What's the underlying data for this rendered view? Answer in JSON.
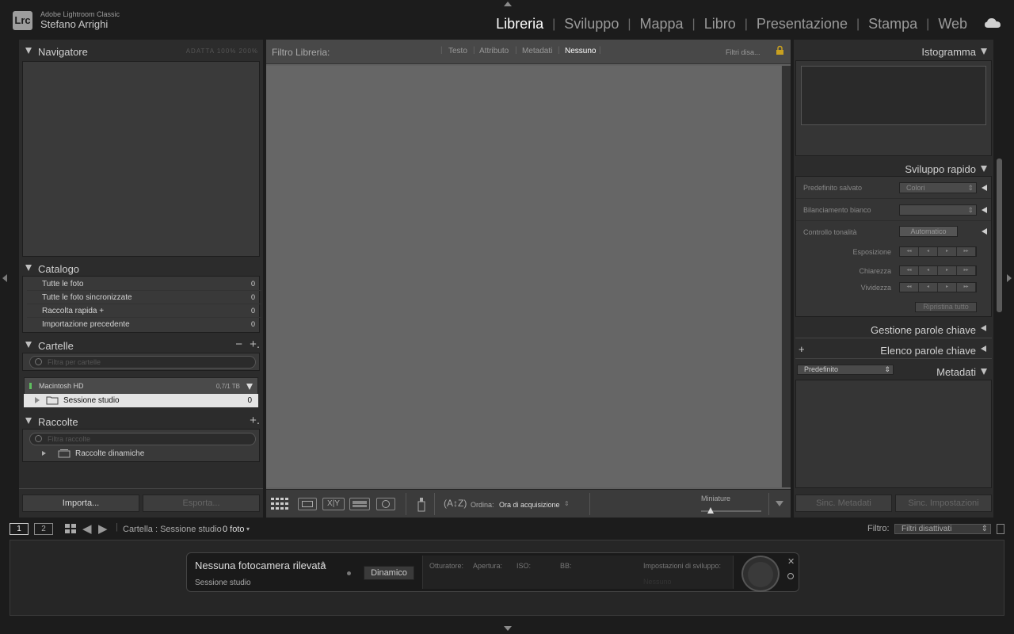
{
  "app": {
    "logo": "Lrc",
    "product": "Adobe Lightroom Classic",
    "user": "Stefano Arrighi"
  },
  "modules": [
    {
      "label": "Libreria",
      "active": true
    },
    {
      "label": "Sviluppo"
    },
    {
      "label": "Mappa"
    },
    {
      "label": "Libro"
    },
    {
      "label": "Presentazione"
    },
    {
      "label": "Stampa"
    },
    {
      "label": "Web"
    }
  ],
  "left": {
    "navigator": {
      "title": "Navigatore",
      "options": "ADATTA  100%  200%"
    },
    "catalog": {
      "title": "Catalogo",
      "items": [
        {
          "label": "Tutte le foto",
          "count": "0"
        },
        {
          "label": "Tutte le foto sincronizzate",
          "count": "0"
        },
        {
          "label": "Raccolta rapida +",
          "count": "0"
        },
        {
          "label": "Importazione precedente",
          "count": "0"
        }
      ]
    },
    "folders": {
      "title": "Cartelle",
      "search_placeholder": "Filtra per cartelle",
      "volume": {
        "name": "Macintosh HD",
        "size": "0,7/1 TB"
      },
      "folder": {
        "name": "Sessione studio",
        "count": "0"
      }
    },
    "collections": {
      "title": "Raccolte",
      "search_placeholder": "Filtra raccolte",
      "item": "Raccolte dinamiche"
    },
    "import_label": "Importa...",
    "export_label": "Esporta..."
  },
  "center": {
    "filter_title": "Filtro Libreria:",
    "filter_tabs": [
      "Testo",
      "Attributo",
      "Metadati",
      "Nessuno"
    ],
    "filter_active": "Nessuno",
    "filter_preset": "Filtri disa...",
    "sort_label": "Ordina:",
    "sort_value": "Ora di acquisizione",
    "thumbnails_label": "Miniature"
  },
  "right": {
    "histogram_title": "Istogramma",
    "quick_develop": {
      "title": "Sviluppo rapido",
      "saved_preset_label": "Predefinito salvato",
      "saved_preset_value": "Colori",
      "wb_label": "Bilanciamento bianco",
      "wb_value": "",
      "tone_label": "Controllo tonalità",
      "tone_button": "Automatico",
      "exposure_label": "Esposizione",
      "clarity_label": "Chiarezza",
      "vibrance_label": "Vividezza",
      "reset_label": "Ripristina tutto"
    },
    "keywording_title": "Gestione parole chiave",
    "keyword_list_title": "Elenco parole chiave",
    "metadata_title": "Metadati",
    "metadata_preset": "Predefinito",
    "sync_metadata": "Sinc. Metadati",
    "sync_settings": "Sinc. Impostazioni"
  },
  "filmstrip": {
    "page1": "1",
    "page2": "2",
    "source": "Cartella : Sessione studio",
    "count": "0 foto",
    "filter_label": "Filtro:",
    "filter_value": "Filtri disattivati"
  },
  "tether": {
    "camera": "Nessuna fotocamera rilevata",
    "session": "Sessione studio",
    "mode": "Dinamico",
    "shutter": "Otturatore:",
    "aperture": "Apertura:",
    "iso": "ISO:",
    "wb": "BB:",
    "develop_settings": "Impostazioni di sviluppo:",
    "develop_value": "Nessuno"
  }
}
